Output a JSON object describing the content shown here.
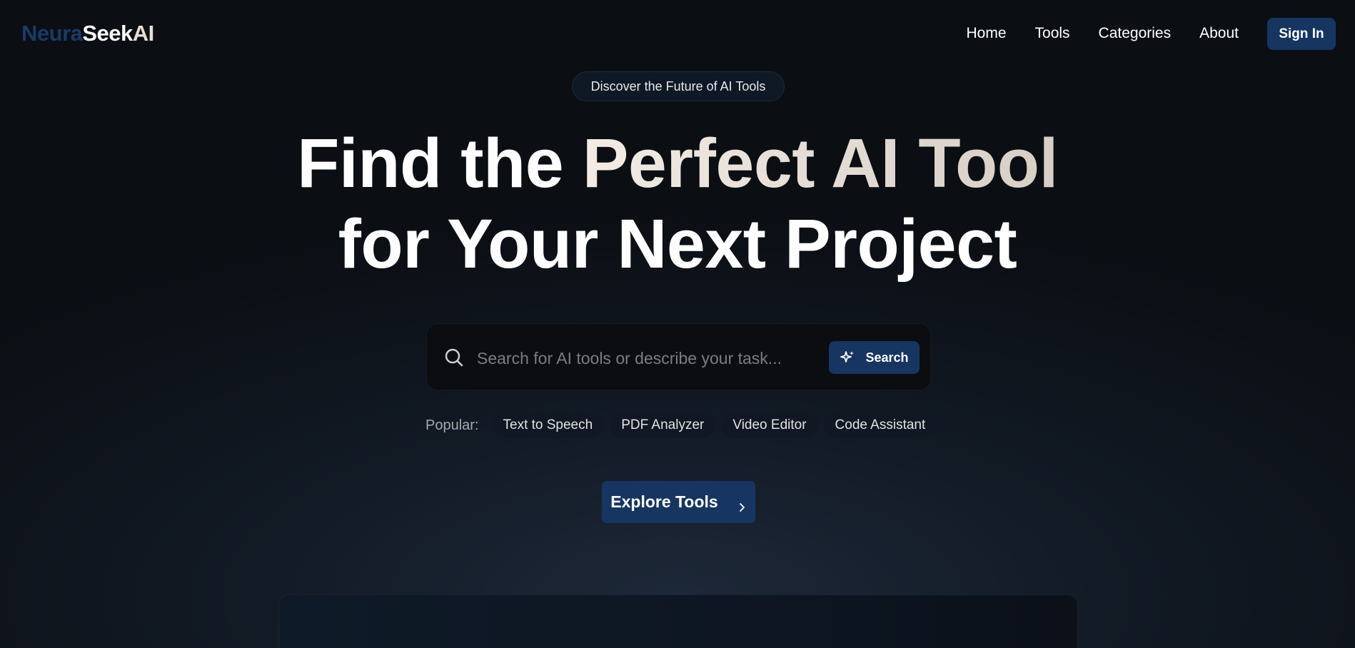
{
  "brand": {
    "part1": "Neura",
    "part2": "Seek",
    "part3": "AI"
  },
  "nav": {
    "items": [
      {
        "label": "Home"
      },
      {
        "label": "Tools"
      },
      {
        "label": "Categories"
      },
      {
        "label": "About"
      }
    ],
    "signin_label": "Sign In"
  },
  "hero": {
    "pill": "Discover the Future of AI Tools",
    "headline_line1_a": "Find the ",
    "headline_line1_b": "Perfect AI Tool",
    "headline_line2": "for Your Next Project"
  },
  "search": {
    "placeholder": "Search for AI tools or describe your task...",
    "value": "",
    "button_label": "Search",
    "icon": "search-icon",
    "button_icon": "sparkle-icon"
  },
  "popular": {
    "label": "Popular:",
    "items": [
      "Text to Speech",
      "PDF Analyzer",
      "Video Editor",
      "Code Assistant"
    ]
  },
  "cta": {
    "explore_label": "Explore Tools",
    "icon": "chevron-right-icon"
  },
  "colors": {
    "accent": "#163561",
    "brand_dark": "#1a3a66",
    "background": "#0b0e13",
    "warm_text": "#e6ddd4"
  }
}
